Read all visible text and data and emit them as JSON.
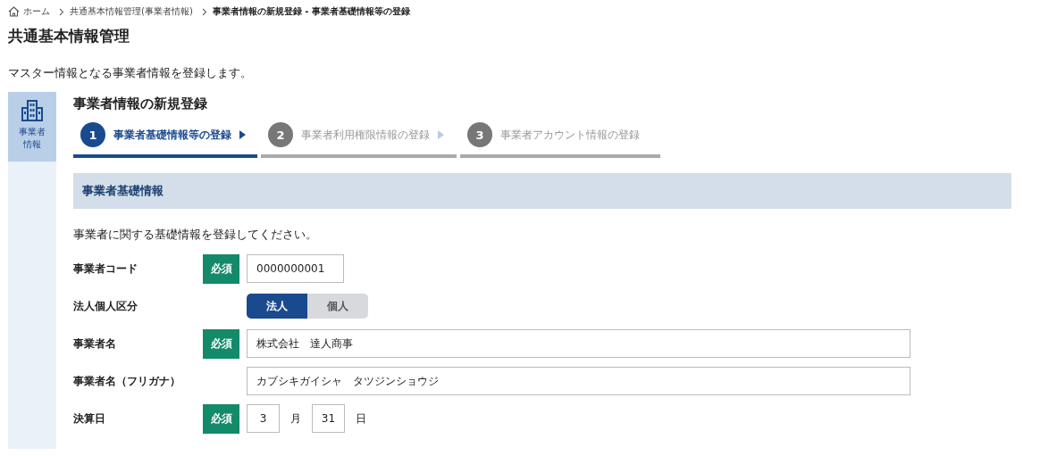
{
  "breadcrumb": [
    {
      "label": "ホーム",
      "kind": "home"
    },
    {
      "label": "共通基本情報管理(事業者情報)",
      "kind": "link"
    },
    {
      "label": "事業者情報の新規登録 - 事業者基礎情報等の登録",
      "kind": "current"
    }
  ],
  "page_title": "共通基本情報管理",
  "description": "マスター情報となる事業者情報を登録します。",
  "sidebar": {
    "items": [
      {
        "label": "事業者情報",
        "selected": true
      }
    ]
  },
  "section_title": "事業者情報の新規登録",
  "steps": [
    {
      "number": "1",
      "label": "事業者基礎情報等の登録",
      "selected": true
    },
    {
      "number": "2",
      "label": "事業者利用権限情報の登録",
      "selected": false
    },
    {
      "number": "3",
      "label": "事業者アカウント情報の登録",
      "selected": false
    }
  ],
  "panel_title": "事業者基礎情報",
  "instruction": "事業者に関する基礎情報を登録してください。",
  "fields": [
    {
      "kind": "short_text",
      "label": "事業者コード",
      "required": true,
      "required_label": "必須",
      "value": "0000000001"
    },
    {
      "kind": "segmented",
      "label": "法人個人区分",
      "required": false,
      "options": [
        {
          "label": "法人",
          "selected": true
        },
        {
          "label": "個人",
          "selected": false
        }
      ]
    },
    {
      "kind": "text",
      "label": "事業者名",
      "required": true,
      "required_label": "必須",
      "value": "株式会社　達人商事"
    },
    {
      "kind": "text",
      "label": "事業者名（フリガナ）",
      "required": false,
      "value": "カブシキガイシャ　タツジンショウジ"
    },
    {
      "kind": "date",
      "label": "決算日",
      "required": true,
      "required_label": "必須",
      "month": "3",
      "month_unit": "月",
      "day": "31",
      "day_unit": "日"
    }
  ]
}
